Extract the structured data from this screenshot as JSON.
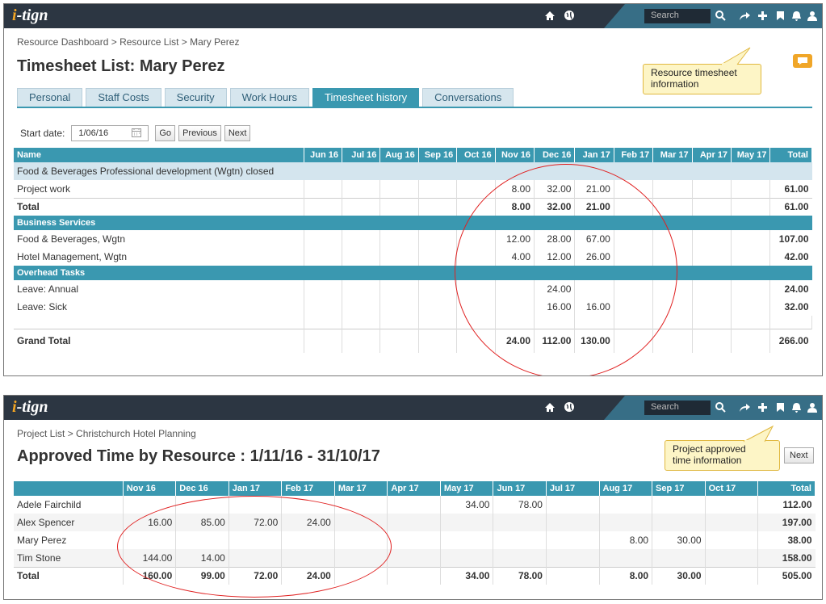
{
  "app": {
    "logo": "itign",
    "search_placeholder": "Search"
  },
  "panel1": {
    "breadcrumb": "Resource Dashboard > Resource List > Mary Perez",
    "title": "Timesheet List: Mary Perez",
    "tabs": [
      "Personal",
      "Staff Costs",
      "Security",
      "Work Hours",
      "Timesheet history",
      "Conversations"
    ],
    "active_tab": "Timesheet history",
    "callout": [
      "Resource timesheet",
      "information"
    ],
    "start_date_label": "Start date:",
    "start_date_value": "1/06/16",
    "buttons": {
      "go": "Go",
      "previous": "Previous",
      "next": "Next"
    },
    "columns": [
      "Name",
      "Jun 16",
      "Jul 16",
      "Aug 16",
      "Sep 16",
      "Oct 16",
      "Nov 16",
      "Dec 16",
      "Jan 17",
      "Feb 17",
      "Mar 17",
      "Apr 17",
      "May 17",
      "Total"
    ],
    "rows": [
      {
        "type": "group",
        "name": "Food & Beverages Professional development (Wgtn) closed"
      },
      {
        "type": "data",
        "name": "Project work",
        "cells": [
          "",
          "",
          "",
          "",
          "",
          "8.00",
          "32.00",
          "21.00",
          "",
          "",
          "",
          ""
        ],
        "total": "61.00"
      },
      {
        "type": "total",
        "name": "Total",
        "cells": [
          "",
          "",
          "",
          "",
          "",
          "8.00",
          "32.00",
          "21.00",
          "",
          "",
          "",
          ""
        ],
        "total": "61.00"
      },
      {
        "type": "section",
        "name": "Business Services"
      },
      {
        "type": "data",
        "name": "Food & Beverages, Wgtn",
        "cells": [
          "",
          "",
          "",
          "",
          "",
          "12.00",
          "28.00",
          "67.00",
          "",
          "",
          "",
          ""
        ],
        "total": "107.00"
      },
      {
        "type": "data",
        "name": "Hotel Management, Wgtn",
        "cells": [
          "",
          "",
          "",
          "",
          "",
          "4.00",
          "12.00",
          "26.00",
          "",
          "",
          "",
          ""
        ],
        "total": "42.00"
      },
      {
        "type": "section",
        "name": "Overhead Tasks"
      },
      {
        "type": "data",
        "name": "Leave: Annual",
        "cells": [
          "",
          "",
          "",
          "",
          "",
          "",
          "24.00",
          "",
          "",
          "",
          "",
          ""
        ],
        "total": "24.00"
      },
      {
        "type": "data",
        "name": "Leave: Sick",
        "cells": [
          "",
          "",
          "",
          "",
          "",
          "",
          "16.00",
          "16.00",
          "",
          "",
          "",
          ""
        ],
        "total": "32.00"
      },
      {
        "type": "spacer"
      },
      {
        "type": "grand",
        "name": "Grand Total",
        "cells": [
          "",
          "",
          "",
          "",
          "",
          "24.00",
          "112.00",
          "130.00",
          "",
          "",
          "",
          ""
        ],
        "total": "266.00"
      }
    ]
  },
  "panel2": {
    "breadcrumb": "Project List > Christchurch Hotel Planning",
    "title": "Approved Time by Resource : 1/11/16 - 31/10/17",
    "callout": [
      "Project approved",
      "time information"
    ],
    "next_button": "Next",
    "columns": [
      "",
      "Nov 16",
      "Dec 16",
      "Jan 17",
      "Feb 17",
      "Mar 17",
      "Apr 17",
      "May 17",
      "Jun 17",
      "Jul 17",
      "Aug 17",
      "Sep 17",
      "Oct 17",
      "Total"
    ],
    "rows": [
      {
        "name": "Adele Fairchild",
        "cells": [
          "",
          "",
          "",
          "",
          "",
          "",
          "34.00",
          "78.00",
          "",
          "",
          "",
          ""
        ],
        "total": "112.00"
      },
      {
        "name": "Alex Spencer",
        "cells": [
          "16.00",
          "85.00",
          "72.00",
          "24.00",
          "",
          "",
          "",
          "",
          "",
          "",
          "",
          ""
        ],
        "total": "197.00"
      },
      {
        "name": "Mary Perez",
        "cells": [
          "",
          "",
          "",
          "",
          "",
          "",
          "",
          "",
          "",
          "8.00",
          "30.00",
          ""
        ],
        "total": "38.00"
      },
      {
        "name": "Tim Stone",
        "cells": [
          "144.00",
          "14.00",
          "",
          "",
          "",
          "",
          "",
          "",
          "",
          "",
          "",
          ""
        ],
        "total": "158.00"
      },
      {
        "name": "Total",
        "cells": [
          "160.00",
          "99.00",
          "72.00",
          "24.00",
          "",
          "",
          "34.00",
          "78.00",
          "",
          "8.00",
          "30.00",
          ""
        ],
        "total": "505.00",
        "bold": true
      }
    ]
  }
}
